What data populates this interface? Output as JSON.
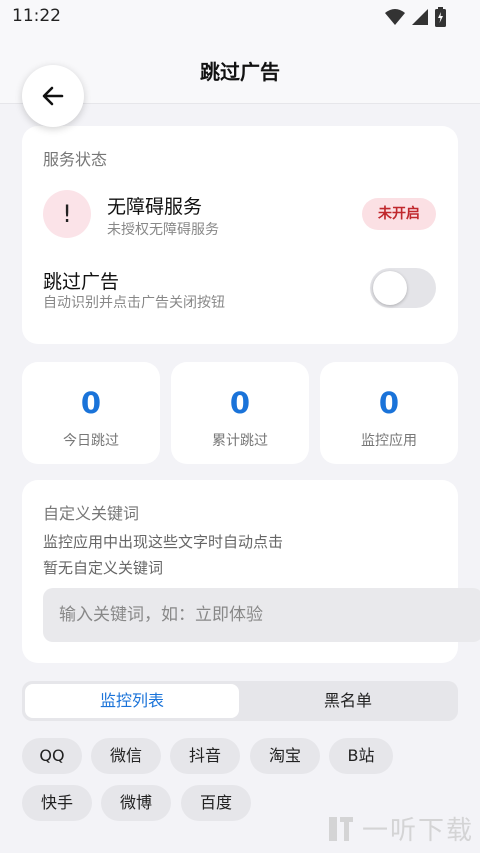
{
  "status_bar": {
    "time": "11:22"
  },
  "header": {
    "title": "跳过广告"
  },
  "service": {
    "section_title": "服务状态",
    "warn_glyph": "!",
    "accessibility_title": "无障碍服务",
    "accessibility_sub": "未授权无障碍服务",
    "badge": "未开启",
    "skip_title": "跳过广告",
    "skip_sub": "自动识别并点击广告关闭按钮",
    "skip_enabled": false
  },
  "stats": [
    {
      "value": "0",
      "label": "今日跳过"
    },
    {
      "value": "0",
      "label": "累计跳过"
    },
    {
      "value": "0",
      "label": "监控应用"
    }
  ],
  "keywords": {
    "title": "自定义关键词",
    "desc": "监控应用中出现这些文字时自动点击",
    "empty": "暂无自定义关键词",
    "input_placeholder": "输入关键词，如：立即体验",
    "input_value": ""
  },
  "tabs": {
    "active": "监控列表",
    "inactive": "黑名单"
  },
  "apps": [
    "QQ",
    "微信",
    "抖音",
    "淘宝",
    "B站",
    "快手",
    "微博",
    "百度"
  ],
  "watermark": "一听下载",
  "colors": {
    "accent": "#1a73d9",
    "danger": "#c0282d",
    "background": "#f3f3f7"
  }
}
